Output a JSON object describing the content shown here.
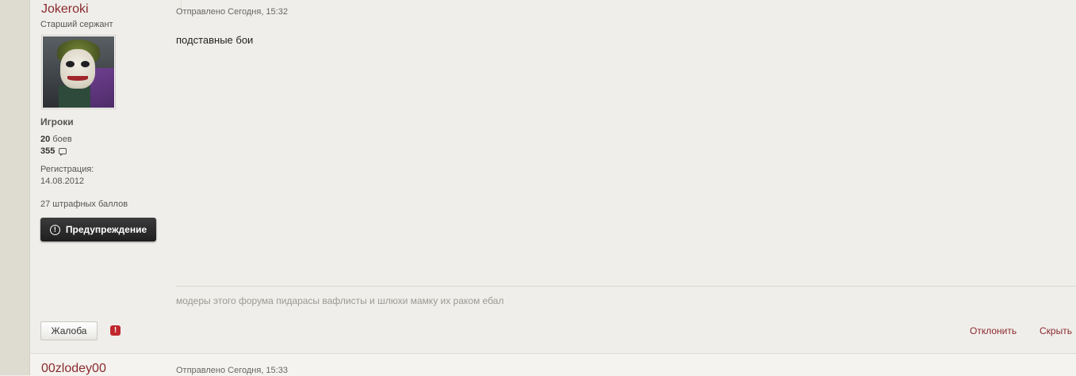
{
  "post": {
    "author": "Jokeroki",
    "rank": "Старший сержант",
    "group": "Игроки",
    "stats": {
      "battles_count": "20",
      "battles_label": "боев",
      "posts_count": "355"
    },
    "registration_label": "Регистрация:",
    "registration_date": "14.08.2012",
    "penalty": "27 штрафных баллов",
    "warn_button": "Предупреждение",
    "posted": "Отправлено Сегодня, 15:32",
    "body": "подставные бои",
    "signature": "модеры этого форума пидарасы вафлисты и шлюхи мамку их раком ебал",
    "report_button": "Жалоба",
    "actions": {
      "reject": "Отклонить",
      "hide": "Скрыть"
    }
  },
  "next_post": {
    "author": "00zlodey00",
    "posted": "Отправлено Сегодня, 15:33"
  },
  "colors": {
    "accent": "#8b2a2f",
    "background": "#efeeea",
    "warn_button": "#2a2a2a",
    "report_icon": "#c0282d"
  }
}
